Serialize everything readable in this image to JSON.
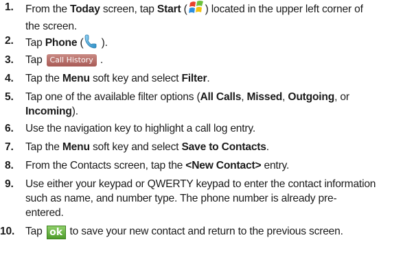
{
  "steps": [
    {
      "num": "1.",
      "line1": {
        "pre": "From the ",
        "b1": "Today",
        "mid": " screen, tap ",
        "b2": "Start",
        "pre_icon": " (",
        "icon": "windows-start-icon",
        "post_icon": ") located in the upper left corner of"
      },
      "line2": "the screen."
    },
    {
      "num": "2.",
      "pre": "Tap ",
      "b1": "Phone",
      "pre_icon": " (",
      "icon": "phone-handset-icon",
      "post_icon": " )."
    },
    {
      "num": "3.",
      "pre": "Tap",
      "button": "Call History",
      "post": "."
    },
    {
      "num": "4.",
      "pre": "Tap the ",
      "b1": "Menu",
      "mid": " soft key and select ",
      "b2": "Filter",
      "post": "."
    },
    {
      "num": "5.",
      "line1": {
        "pre": "Tap one of the available filter options (",
        "b1": "All Calls",
        "sep1": ", ",
        "b2": "Missed",
        "sep2": ", ",
        "b3": "Outgoing",
        "post": ", or"
      },
      "line2": {
        "b1": "Incoming",
        "post": ")."
      }
    },
    {
      "num": "6.",
      "text": "Use the navigation key to highlight a call log entry."
    },
    {
      "num": "7.",
      "pre": "Tap the ",
      "b1": "Menu",
      "mid": " soft key and select ",
      "b2": "Save to Contacts",
      "post": "."
    },
    {
      "num": "8.",
      "pre": "From the Contacts screen, tap the ",
      "b1": "<New Contact>",
      "post": " entry."
    },
    {
      "num": "9.",
      "line1": "Use either your keypad or QWERTY keypad to enter the contact information",
      "line2": "such as name, and number type. The phone number is already pre-",
      "line3": "entered."
    },
    {
      "num": "10.",
      "pre": "Tap",
      "button": "ok",
      "post": "to save your new contact and return to the previous screen."
    }
  ],
  "colors": {
    "call_history_button": "#b56a64",
    "ok_button": "#5aa832",
    "text": "#1a1a1a"
  }
}
